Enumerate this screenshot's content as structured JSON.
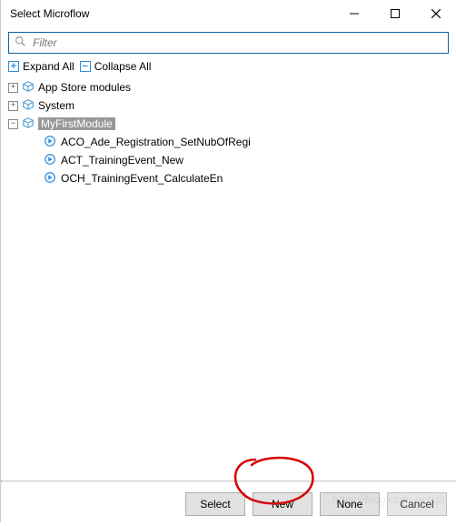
{
  "window": {
    "title": "Select Microflow"
  },
  "filter": {
    "placeholder": "Filter"
  },
  "toolbar": {
    "expand_all": "Expand All",
    "collapse_all": "Collapse All"
  },
  "tree": {
    "modules": [
      {
        "name": "App Store modules",
        "expanded": false
      },
      {
        "name": "System",
        "expanded": false
      },
      {
        "name": "MyFirstModule",
        "expanded": true,
        "selected": true
      }
    ],
    "microflows": [
      "ACO_Ade_Registration_SetNubOfRegi",
      "ACT_TrainingEvent_New",
      "OCH_TrainingEvent_CalculateEn"
    ]
  },
  "buttons": {
    "select": "Select",
    "new": "New",
    "none": "None",
    "cancel": "Cancel"
  },
  "watermark": "https://blog.csdn.net/qq"
}
